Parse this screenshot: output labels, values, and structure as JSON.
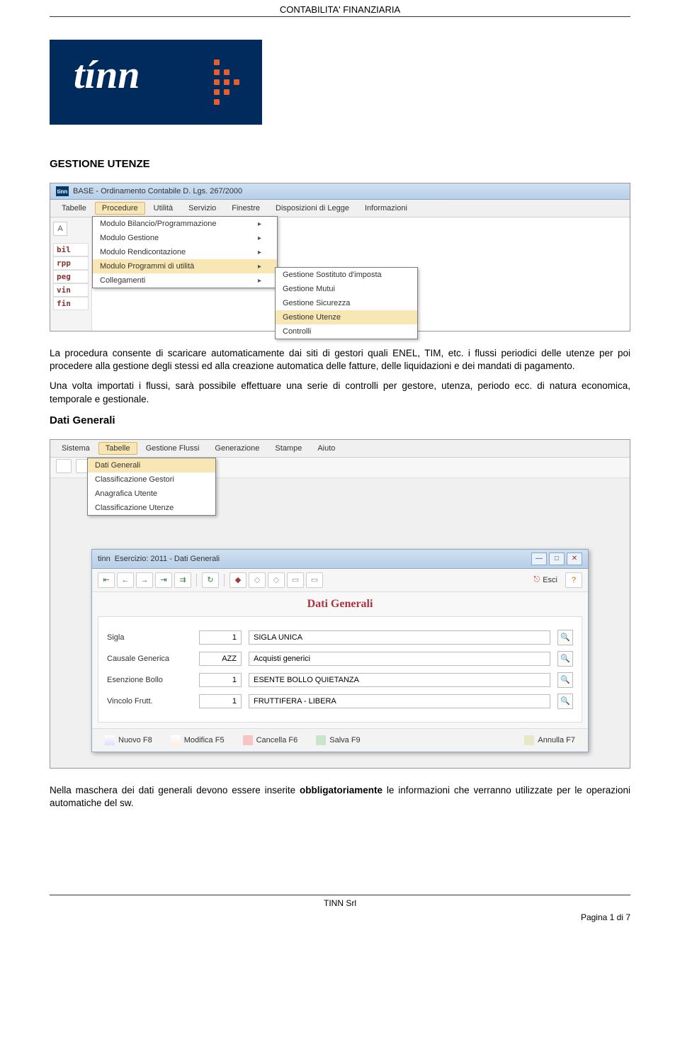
{
  "header": {
    "title": "CONTABILITA' FINANZIARIA"
  },
  "logo": {
    "text": "tínn"
  },
  "section1": {
    "title": "GESTIONE UTENZE"
  },
  "screenshot1": {
    "window_title": "BASE - Ordinamento Contabile D. Lgs. 267/2000",
    "menu": [
      "Tabelle",
      "Procedure",
      "Utilità",
      "Servizio",
      "Finestre",
      "Disposizioni di Legge",
      "Informazioni"
    ],
    "menu_active": "Procedure",
    "sidebar_tabs": [
      "bil",
      "rpp",
      "peg",
      "vin",
      "fin"
    ],
    "dropdown1": [
      {
        "label": "Modulo Bilancio/Programmazione",
        "arrow": true
      },
      {
        "label": "Modulo Gestione",
        "arrow": true
      },
      {
        "label": "Modulo Rendicontazione",
        "arrow": true
      },
      {
        "label": "Modulo Programmi di utilità",
        "arrow": true,
        "hl": true
      },
      {
        "label": "Collegamenti",
        "arrow": true
      }
    ],
    "dropdown2": [
      {
        "label": "Gestione Sostituto d'imposta"
      },
      {
        "label": "Gestione Mutui"
      },
      {
        "label": "Gestione Sicurezza"
      },
      {
        "label": "Gestione Utenze",
        "hl": true
      },
      {
        "label": "Controlli"
      }
    ]
  },
  "paragraphs": {
    "p1": "La procedura consente di scaricare automaticamente dai siti di gestori quali ENEL, TIM, etc. i flussi periodici delle utenze per poi procedere alla gestione degli stessi ed alla creazione automatica delle fatture, delle liquidazioni e dei mandati di pagamento.",
    "p2": "Una volta importati i flussi, sarà possibile effettuare una serie di controlli per gestore, utenza, periodo ecc. di natura economica, temporale e gestionale."
  },
  "section2": {
    "title": "Dati Generali"
  },
  "screenshot2": {
    "menu": [
      "Sistema",
      "Tabelle",
      "Gestione Flussi",
      "Generazione",
      "Stampe",
      "Aiuto"
    ],
    "menu_active": "Tabelle",
    "dropdown": [
      "Dati Generali",
      "Classificazione Gestori",
      "Anagrafica Utente",
      "Classificazione Utenze"
    ],
    "dropdown_hl": "Dati Generali",
    "dialog": {
      "title": "Esercizio: 2011 - Dati Generali",
      "esci": "Esci",
      "heading": "Dati Generali",
      "rows": [
        {
          "label": "Sigla",
          "code": "1",
          "desc": "SIGLA UNICA"
        },
        {
          "label": "Causale Generica",
          "code": "AZZ",
          "desc": "Acquisti generici"
        },
        {
          "label": "Esenzione Bollo",
          "code": "1",
          "desc": "ESENTE BOLLO QUIETANZA"
        },
        {
          "label": "Vincolo Frutt.",
          "code": "1",
          "desc": "FRUTTIFERA - LIBERA"
        }
      ],
      "footer": [
        {
          "label": "Nuovo F8",
          "cls": "ic-new"
        },
        {
          "label": "Modifica F5",
          "cls": "ic-edit"
        },
        {
          "label": "Cancella F6",
          "cls": "ic-del"
        },
        {
          "label": "Salva F9",
          "cls": "ic-save"
        },
        {
          "label": "Annulla F7",
          "cls": "ic-undo"
        }
      ]
    }
  },
  "paragraphs2": {
    "p3a": "Nella maschera dei dati generali devono essere inserite ",
    "p3b": "obbligatoriamente",
    "p3c": " le informazioni che verranno utilizzate per le operazioni automatiche del sw."
  },
  "footer": {
    "company": "TINN  Srl",
    "page": "Pagina 1 di 7"
  }
}
